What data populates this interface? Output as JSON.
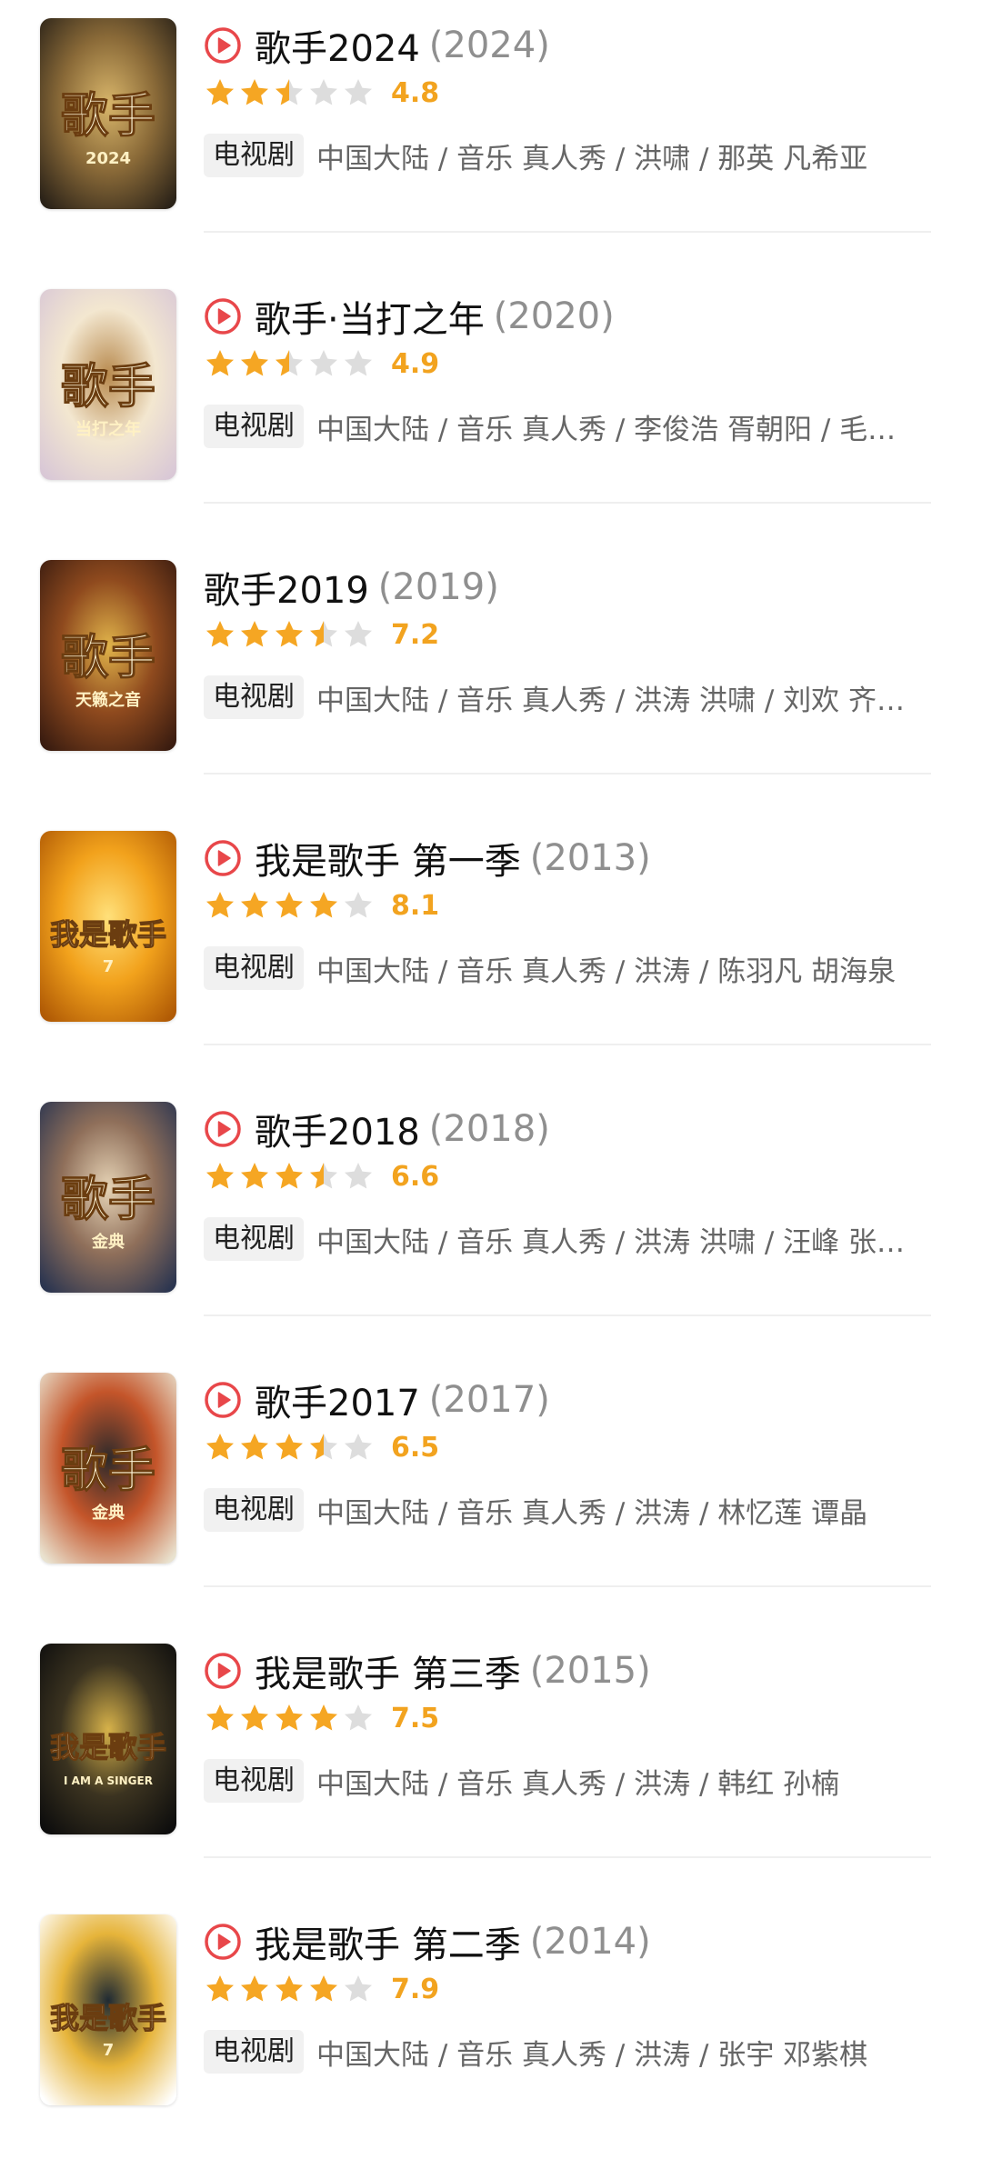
{
  "colors": {
    "accent_play": "#e8474a",
    "star_on": "#f5a623",
    "star_off": "#dddddd",
    "score": "#f2a31f",
    "year": "#8f8f8f",
    "meta": "#666666",
    "tag_bg": "#f1f1f1"
  },
  "items": [
    {
      "title": "歌手2024",
      "year": "(2024)",
      "has_play": true,
      "stars": 2.5,
      "score": "4.8",
      "tag": "电视剧",
      "meta": "中国大陆 / 音乐 真人秀 / 洪啸 / 那英 凡希亚",
      "poster_icon": "poster-singer-2024",
      "poster_text": "歌手",
      "poster_sub": "2024",
      "poster_colors": [
        "#2a2218",
        "#8a6a38",
        "#d8b56a"
      ]
    },
    {
      "title": "歌手·当打之年",
      "year": "(2020)",
      "has_play": true,
      "stars": 2.5,
      "score": "4.9",
      "tag": "电视剧",
      "meta": "中国大陆 / 音乐 真人秀 / 李俊浩 胥朝阳 / 毛…",
      "poster_icon": "poster-singer-2020",
      "poster_text": "歌手",
      "poster_sub": "当打之年",
      "poster_colors": [
        "#d9c8d6",
        "#f3e7d0",
        "#b88a4e"
      ]
    },
    {
      "title": "歌手2019",
      "year": "(2019)",
      "has_play": false,
      "stars": 3.5,
      "score": "7.2",
      "tag": "电视剧",
      "meta": "中国大陆 / 音乐 真人秀 / 洪涛 洪啸 / 刘欢 齐…",
      "poster_icon": "poster-singer-2019",
      "poster_text": "歌手",
      "poster_sub": "天籁之音",
      "poster_colors": [
        "#3a1c10",
        "#8f4a1e",
        "#e0b34a"
      ]
    },
    {
      "title": "我是歌手 第一季",
      "year": "(2013)",
      "has_play": true,
      "stars": 4,
      "score": "8.1",
      "tag": "电视剧",
      "meta": "中国大陆 / 音乐 真人秀 / 洪涛 / 陈羽凡 胡海泉",
      "poster_icon": "poster-i-am-singer-s1",
      "poster_text": "我是歌手",
      "poster_sub": "7",
      "poster_colors": [
        "#b05a05",
        "#f2a21c",
        "#ffe07a"
      ]
    },
    {
      "title": "歌手2018",
      "year": "(2018)",
      "has_play": true,
      "stars": 3.5,
      "score": "6.6",
      "tag": "电视剧",
      "meta": "中国大陆 / 音乐 真人秀 / 洪涛 洪啸 / 汪峰 张…",
      "poster_icon": "poster-singer-2018",
      "poster_text": "歌手",
      "poster_sub": "金典",
      "poster_colors": [
        "#2b3550",
        "#8f6f5a",
        "#e6d3b5"
      ]
    },
    {
      "title": "歌手2017",
      "year": "(2017)",
      "has_play": true,
      "stars": 3.5,
      "score": "6.5",
      "tag": "电视剧",
      "meta": "中国大陆 / 音乐 真人秀 / 洪涛 / 林忆莲 谭晶",
      "poster_icon": "poster-singer-2017",
      "poster_text": "歌手",
      "poster_sub": "金典",
      "poster_colors": [
        "#e9e2cf",
        "#c4552a",
        "#2e2a2a"
      ]
    },
    {
      "title": "我是歌手 第三季",
      "year": "(2015)",
      "has_play": true,
      "stars": 4,
      "score": "7.5",
      "tag": "电视剧",
      "meta": "中国大陆 / 音乐 真人秀 / 洪涛 / 韩红 孙楠",
      "poster_icon": "poster-i-am-singer-s3",
      "poster_text": "我是歌手",
      "poster_sub": "I AM A SINGER",
      "poster_colors": [
        "#0d0d0d",
        "#3b3320",
        "#d7b24a"
      ]
    },
    {
      "title": "我是歌手 第二季",
      "year": "(2014)",
      "has_play": true,
      "stars": 4,
      "score": "7.9",
      "tag": "电视剧",
      "meta": "中国大陆 / 音乐 真人秀 / 洪涛 / 张宇 邓紫棋",
      "poster_icon": "poster-i-am-singer-s2",
      "poster_text": "我是歌手",
      "poster_sub": "7",
      "poster_colors": [
        "#ffffff",
        "#e6b43a",
        "#1f2a33"
      ]
    }
  ]
}
